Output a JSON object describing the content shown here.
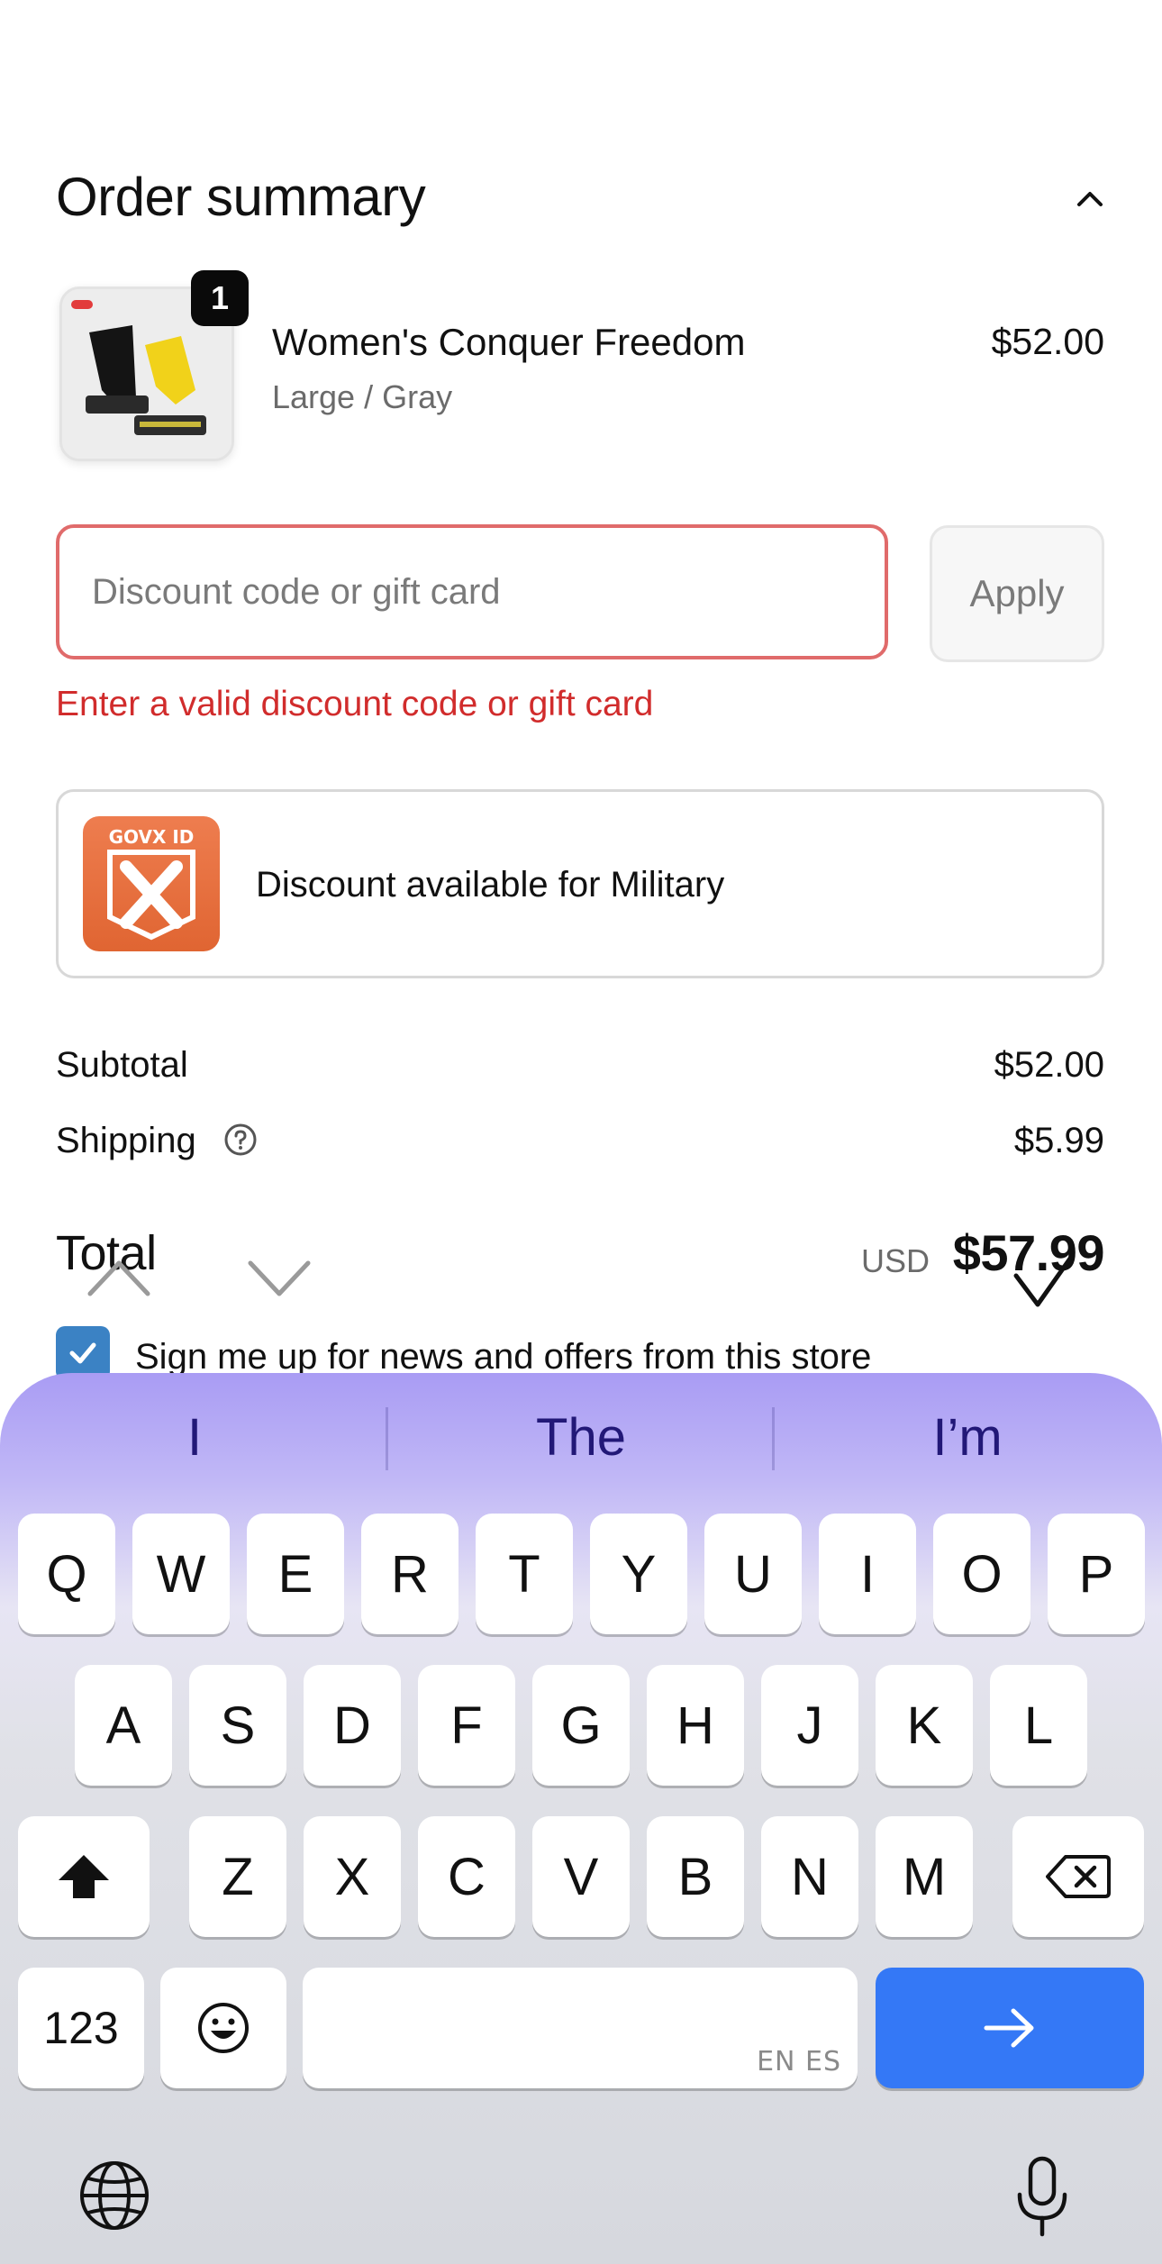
{
  "order_summary": {
    "title": "Order summary",
    "collapse_icon": "chevron-up-icon"
  },
  "product": {
    "quantity": "1",
    "name": "Women's Conquer Freedom",
    "variant": "Large / Gray",
    "price": "$52.00"
  },
  "discount": {
    "placeholder": "Discount code or gift card",
    "value": "",
    "apply_label": "Apply",
    "error": "Enter a valid discount code or gift card"
  },
  "military": {
    "logo_text": "GOVX ID",
    "text": "Discount available for Military"
  },
  "totals": {
    "subtotal_label": "Subtotal",
    "subtotal_value": "$52.00",
    "shipping_label": "Shipping",
    "shipping_value": "$5.99",
    "total_label": "Total",
    "currency": "USD",
    "total_value": "$57.99"
  },
  "newsletter": {
    "checked": true,
    "label": "Sign me up for news and offers from this store"
  },
  "colors": {
    "error": "#d12c2c",
    "checkbox": "#3b82c4",
    "go_key": "#3478f6"
  },
  "keyboard": {
    "suggestions": [
      "I",
      "The",
      "I’m"
    ],
    "row1": [
      "Q",
      "W",
      "E",
      "R",
      "T",
      "Y",
      "U",
      "I",
      "O",
      "P"
    ],
    "row2": [
      "A",
      "S",
      "D",
      "F",
      "G",
      "H",
      "J",
      "K",
      "L"
    ],
    "row3": [
      "Z",
      "X",
      "C",
      "V",
      "B",
      "N",
      "M"
    ],
    "numbers_key": "123",
    "space_languages": "EN ES",
    "icons": [
      "shift-icon",
      "backspace-icon",
      "emoji-icon",
      "arrow-right-icon",
      "globe-icon",
      "microphone-icon"
    ]
  }
}
